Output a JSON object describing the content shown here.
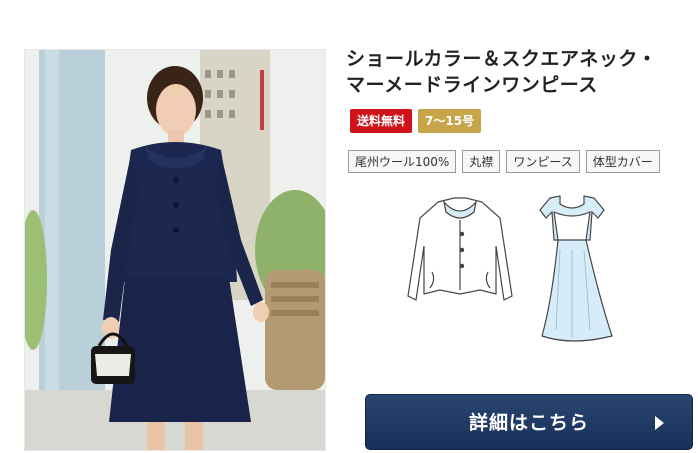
{
  "product": {
    "title_line1": "ショールカラー＆スクエアネック・",
    "title_line2": "マーメードラインワンピース",
    "badges": [
      {
        "label": "送料無料",
        "color": "#d0121b"
      },
      {
        "label": "7〜15号",
        "color": "#c9a54a"
      }
    ],
    "tags": [
      "尾州ウール100%",
      "丸襟",
      "ワンピース",
      "体型カバー"
    ],
    "detail_button_label": "詳細はこちら",
    "colors": {
      "navy_suit": "#1d2850",
      "button_bg": "#1f3a64",
      "sketch_fill": "#d6ecf8"
    },
    "icons": {
      "photo": "model-photo",
      "jacket": "jacket-sketch-icon",
      "dress": "dress-sketch-icon",
      "arrow": "arrow-right-icon"
    }
  }
}
